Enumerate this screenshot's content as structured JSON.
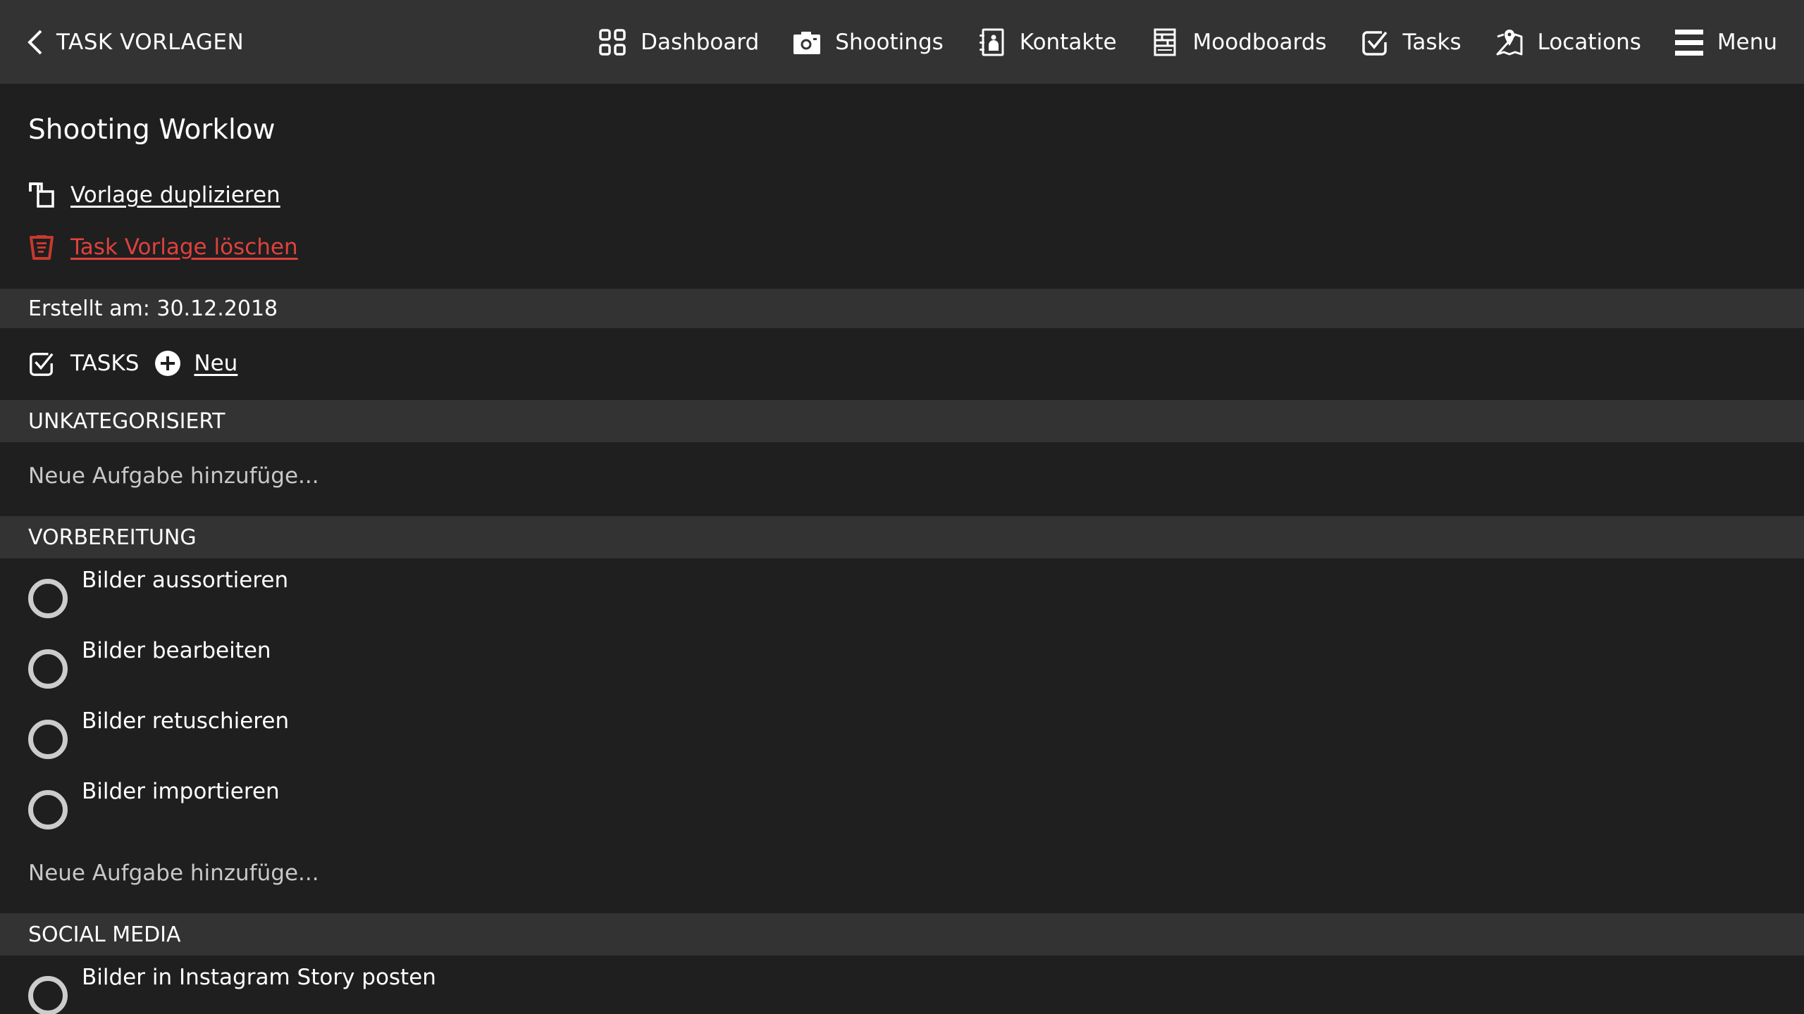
{
  "header": {
    "back_label": "TASK VORLAGEN",
    "nav": [
      {
        "label": "Dashboard",
        "icon": "dashboard-grid-icon"
      },
      {
        "label": "Shootings",
        "icon": "camera-icon"
      },
      {
        "label": "Kontakte",
        "icon": "contacts-book-icon"
      },
      {
        "label": "Moodboards",
        "icon": "moodboard-icon"
      },
      {
        "label": "Tasks",
        "icon": "checkbox-icon"
      },
      {
        "label": "Locations",
        "icon": "map-pin-icon"
      },
      {
        "label": "Menu",
        "icon": "hamburger-menu-icon"
      }
    ]
  },
  "template": {
    "title": "Shooting Worklow",
    "duplicate_label": "Vorlage duplizieren",
    "delete_label": "Task Vorlage löschen",
    "created": "Erstellt am: 30.12.2018"
  },
  "tasks": {
    "label": "TASKS",
    "new_label": "Neu",
    "add_placeholder": "Neue Aufgabe hinzufüge...",
    "categories": [
      {
        "name": "UNKATEGORISIERT",
        "items": []
      },
      {
        "name": "VORBEREITUNG",
        "items": [
          {
            "label": "Bilder aussortieren",
            "done": false
          },
          {
            "label": "Bilder bearbeiten",
            "done": false
          },
          {
            "label": "Bilder retuschieren",
            "done": false
          },
          {
            "label": "Bilder importieren",
            "done": false
          }
        ]
      },
      {
        "name": "SOCIAL MEDIA",
        "items": [
          {
            "label": "Bilder in Instagram Story posten",
            "done": false
          }
        ]
      }
    ]
  },
  "colors": {
    "header_bg": "#333333",
    "body_bg": "#1f1f1f",
    "danger": "#e0413d",
    "placeholder": "#c8c8c8"
  }
}
